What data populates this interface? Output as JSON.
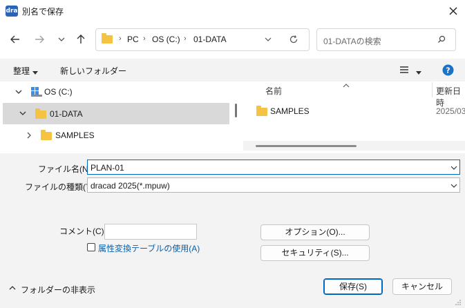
{
  "window": {
    "app_icon_text": "dra",
    "title": "別名で保存"
  },
  "address": {
    "crumbs": [
      "PC",
      "OS (C:)",
      "01-DATA"
    ]
  },
  "search": {
    "placeholder": "01-DATAの検索"
  },
  "toolbar": {
    "organize_label": "整理",
    "new_folder_label": "新しいフォルダー"
  },
  "tree": {
    "items": [
      {
        "label": "OS (C:)",
        "expanded": true,
        "icon": "drive-icon"
      },
      {
        "label": "01-DATA",
        "expanded": true,
        "selected": true,
        "icon": "folder-icon"
      },
      {
        "label": "SAMPLES",
        "expanded": false,
        "icon": "folder-icon"
      }
    ]
  },
  "list": {
    "columns": [
      "名前",
      "更新日時"
    ],
    "rows": [
      {
        "name": "SAMPLES",
        "modified": "2025/03"
      }
    ]
  },
  "form": {
    "filename_label": "ファイル名(N):",
    "filename_value": "PLAN-01",
    "filetype_label": "ファイルの種類(T):",
    "filetype_value": "dracad 2025(*.mpuw)",
    "comment_label": "コメント(C)：",
    "comment_value": "",
    "attr_checkbox_label": "属性変換テーブルの使用(A)",
    "attr_checked": false,
    "options_label": "オプション(O)...",
    "security_label": "セキュリティ(S)..."
  },
  "footer": {
    "hide_folders_label": "フォルダーの非表示",
    "save_label": "保存(S)",
    "cancel_label": "キャンセル"
  },
  "colors": {
    "accent": "#0067c0",
    "folder": "#f5c342",
    "selected_row": "#d9d9d9",
    "help": "#1a73c8"
  }
}
